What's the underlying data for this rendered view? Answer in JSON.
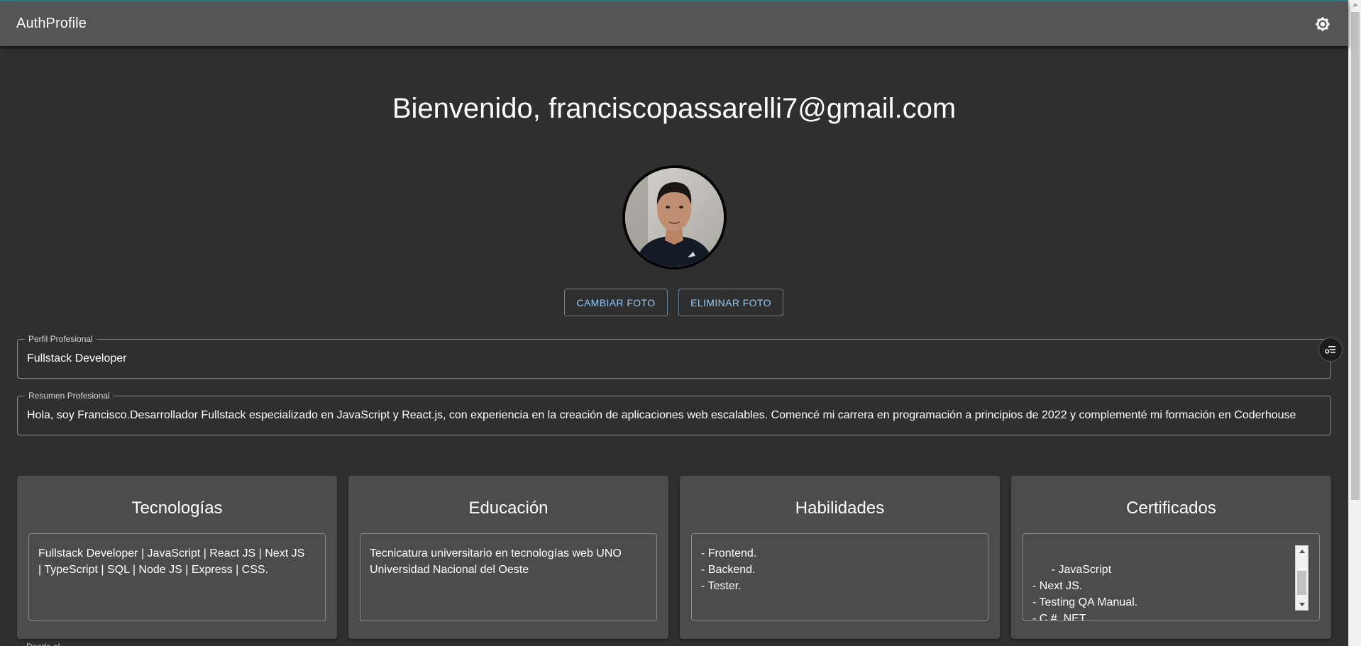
{
  "app": {
    "title": "AuthProfile",
    "theme_toggle_icon": "brightness-icon"
  },
  "welcome": {
    "text": "Bienvenido, franciscopassarelli7@gmail.com"
  },
  "avatar": {
    "icon": "profile-photo"
  },
  "photo_actions": {
    "change_label": "CAMBIAR FOTO",
    "delete_label": "ELIMINAR FOTO"
  },
  "profile": {
    "professional_label": "Perfil Profesional",
    "professional_value": "Fullstack Developer",
    "summary_label": "Resumen Profesional",
    "summary_value": "Hola, soy Francisco.Desarrollador Fullstack especializado en JavaScript y React.js, con experiencia en la creación de aplicaciones web escalables. Comencé mi carrera en programación a principios de 2022 y complementé mi formación en Coderhouse"
  },
  "fab": {
    "icon": "settings-list-icon"
  },
  "cards": [
    {
      "title": "Tecnologías",
      "content": "Fullstack Developer | JavaScript | React JS | Next JS\n| TypeScript | SQL | Node JS | Express | CSS."
    },
    {
      "title": "Educación",
      "content": "Tecnicatura universitario en tecnologías web UNO\nUniversidad Nacional del Oeste"
    },
    {
      "title": "Habilidades",
      "content": "- Frontend.\n- Backend.\n- Tester."
    },
    {
      "title": "Certificados",
      "content": "- JavaScript\n- Next JS.\n- Testing QA Manual.\n- C # .NET"
    }
  ],
  "bottom": {
    "peek_label": "Desde el"
  },
  "colors": {
    "background": "#2f2f2f",
    "appbar": "#555555",
    "card": "#4c4c4c",
    "accent": "#90caf9"
  }
}
